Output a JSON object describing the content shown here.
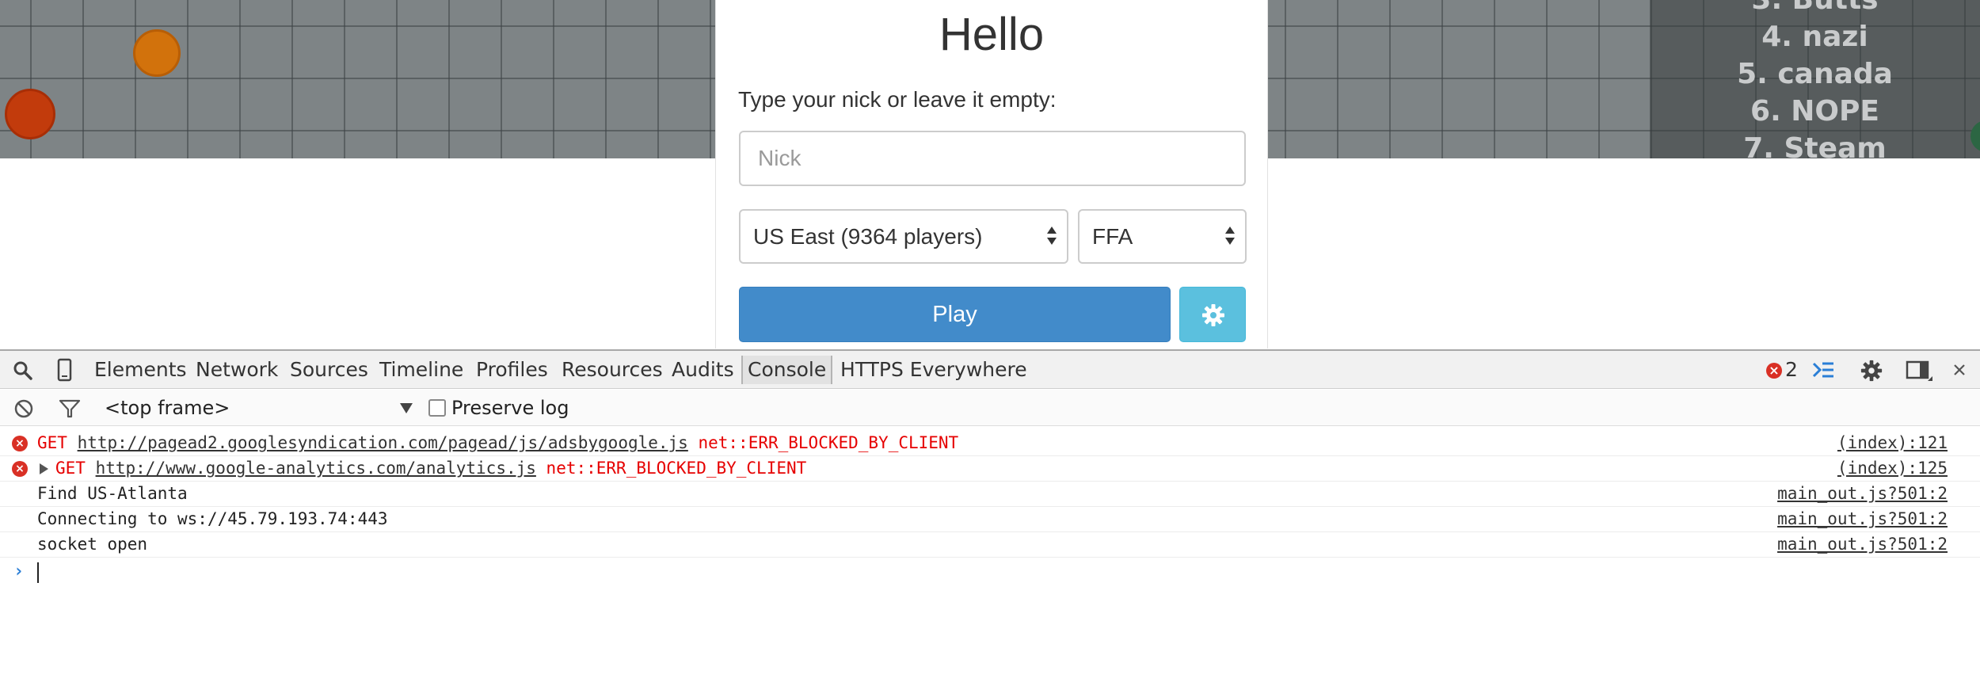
{
  "game": {
    "leaderboard": [
      "3. Butts",
      "4. nazi",
      "5. canada",
      "6. NOPE",
      "7. Steam"
    ]
  },
  "dialog": {
    "title": "Hello",
    "nick_label": "Type your nick or leave it empty:",
    "nick_placeholder": "Nick",
    "nick_value": "",
    "region_selected": "US East (9364 players)",
    "mode_selected": "FFA",
    "play_label": "Play",
    "settings_icon": "gear-icon",
    "colors": {
      "play": "#428bca",
      "settings": "#5bc0de"
    }
  },
  "devtools": {
    "tabs": [
      "Elements",
      "Network",
      "Sources",
      "Timeline",
      "Profiles",
      "Resources",
      "Audits",
      "Console",
      "HTTPS Everywhere"
    ],
    "active_tab": "Console",
    "error_count": "2",
    "frame": "<top frame>",
    "preserve_log_label": "Preserve log",
    "preserve_log_checked": false,
    "console": {
      "errors": [
        {
          "method": "GET",
          "url": "http://pagead2.googlesyndication.com/pagead/js/adsbygoogle.js",
          "error": "net::ERR_BLOCKED_BY_CLIENT",
          "source": "(index):121"
        },
        {
          "method": "GET",
          "url": "http://www.google-analytics.com/analytics.js",
          "error": "net::ERR_BLOCKED_BY_CLIENT",
          "source": "(index):125"
        }
      ],
      "logs": [
        {
          "text": "Find US-Atlanta",
          "source": "main_out.js?501:2"
        },
        {
          "text": "Connecting to ws://45.79.193.74:443",
          "source": "main_out.js?501:2"
        },
        {
          "text": "socket open",
          "source": "main_out.js?501:2"
        }
      ]
    }
  }
}
